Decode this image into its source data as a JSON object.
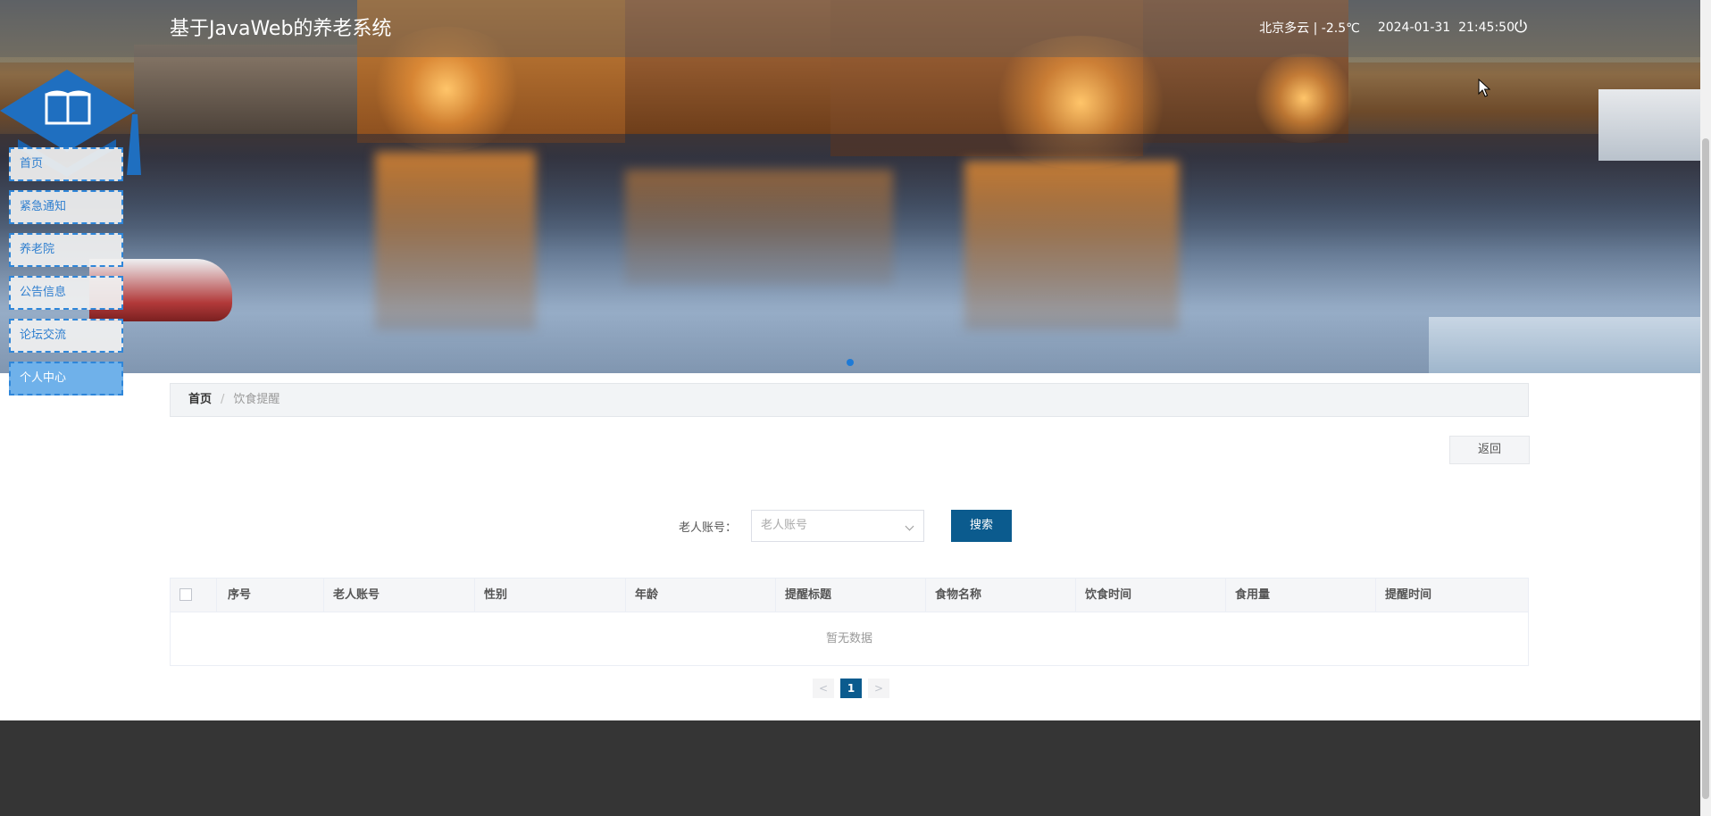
{
  "header": {
    "site_title": "基于JavaWeb的养老系统",
    "weather": "北京多云 | -2.5℃",
    "date": "2024-01-31",
    "time": "21:45:50"
  },
  "nav": {
    "items": [
      "首页",
      "紧急通知",
      "养老院",
      "公告信息",
      "论坛交流",
      "个人中心"
    ],
    "active_index": 5
  },
  "breadcrumb": {
    "home": "首页",
    "separator": "/",
    "current": "饮食提醒"
  },
  "actions": {
    "back_label": "返回"
  },
  "search": {
    "label": "老人账号：",
    "placeholder": "老人账号",
    "button_label": "搜索"
  },
  "table": {
    "columns": [
      "序号",
      "老人账号",
      "性别",
      "年龄",
      "提醒标题",
      "食物名称",
      "饮食时间",
      "食用量",
      "提醒时间"
    ],
    "empty_text": "暂无数据"
  },
  "pagination": {
    "prev": "<",
    "current_page": "1",
    "next": ">"
  },
  "colors": {
    "primary": "#0b5b8e",
    "nav_border": "#2f86d9",
    "nav_active": "#6fb1ea",
    "footer": "#353535"
  },
  "icons": {
    "power": "power-icon",
    "logo": "book-logo-icon",
    "select": "chevron-down-icon"
  }
}
